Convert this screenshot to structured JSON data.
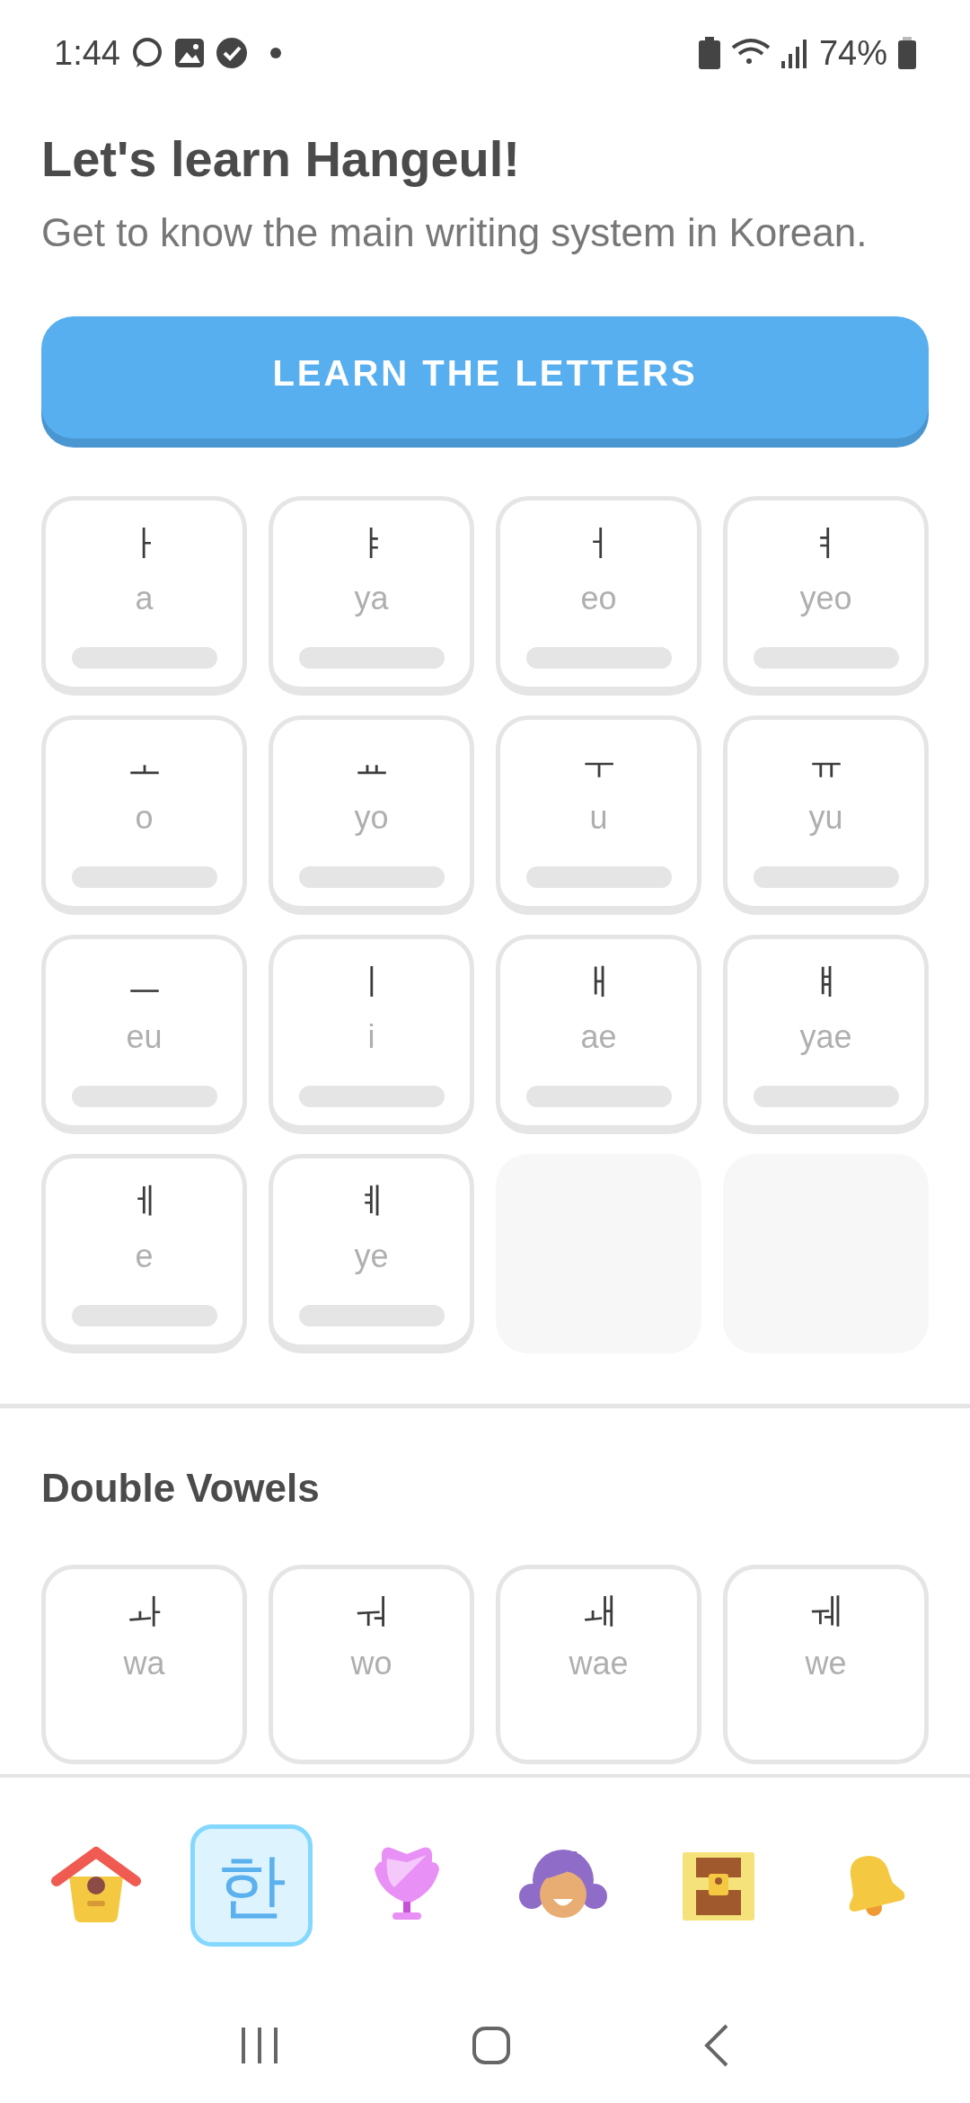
{
  "status_bar": {
    "time": "1:44",
    "battery": "74%"
  },
  "header": {
    "title": "Let's learn Hangeul!",
    "subtitle": "Get to know the main writing system in Korean."
  },
  "learn_button": "LEARN THE LETTERS",
  "letters": [
    {
      "kind": "letter",
      "char": "ㅏ",
      "roman": "a",
      "level": 0
    },
    {
      "kind": "letter",
      "char": "ㅑ",
      "roman": "ya",
      "level": 0
    },
    {
      "kind": "letter",
      "char": "ㅓ",
      "roman": "eo",
      "level": 0
    },
    {
      "kind": "letter",
      "char": "ㅕ",
      "roman": "yeo",
      "level": 0
    },
    {
      "kind": "letter",
      "char": "ㅗ",
      "roman": "o",
      "level": 0
    },
    {
      "kind": "letter",
      "char": "ㅛ",
      "roman": "yo",
      "level": 0
    },
    {
      "kind": "letter",
      "char": "ㅜ",
      "roman": "u",
      "level": 0
    },
    {
      "kind": "letter",
      "char": "ㅠ",
      "roman": "yu",
      "level": 0
    },
    {
      "kind": "letter",
      "char": "ㅡ",
      "roman": "eu",
      "level": 0
    },
    {
      "kind": "letter",
      "char": "ㅣ",
      "roman": "i",
      "level": 0
    },
    {
      "kind": "letter",
      "char": "ㅐ",
      "roman": "ae",
      "level": 0
    },
    {
      "kind": "letter",
      "char": "ㅒ",
      "roman": "yae",
      "level": 0
    },
    {
      "kind": "letter",
      "char": "ㅔ",
      "roman": "e",
      "level": 0
    },
    {
      "kind": "letter",
      "char": "ㅖ",
      "roman": "ye",
      "level": 0
    },
    {
      "kind": "empty"
    },
    {
      "kind": "empty"
    }
  ],
  "double_vowels": {
    "title": "Double Vowels",
    "letters": [
      {
        "char": "ㅘ",
        "roman": "wa"
      },
      {
        "char": "ㅝ",
        "roman": "wo"
      },
      {
        "char": "ㅙ",
        "roman": "wae"
      },
      {
        "char": "ㅞ",
        "roman": "we"
      }
    ]
  },
  "nav": [
    {
      "kind": "home",
      "selected": false
    },
    {
      "kind": "letters",
      "glyph": "한",
      "selected": true
    },
    {
      "kind": "shield",
      "selected": false
    },
    {
      "kind": "profile",
      "selected": false
    },
    {
      "kind": "chest",
      "selected": false
    },
    {
      "kind": "bell",
      "selected": false
    }
  ]
}
